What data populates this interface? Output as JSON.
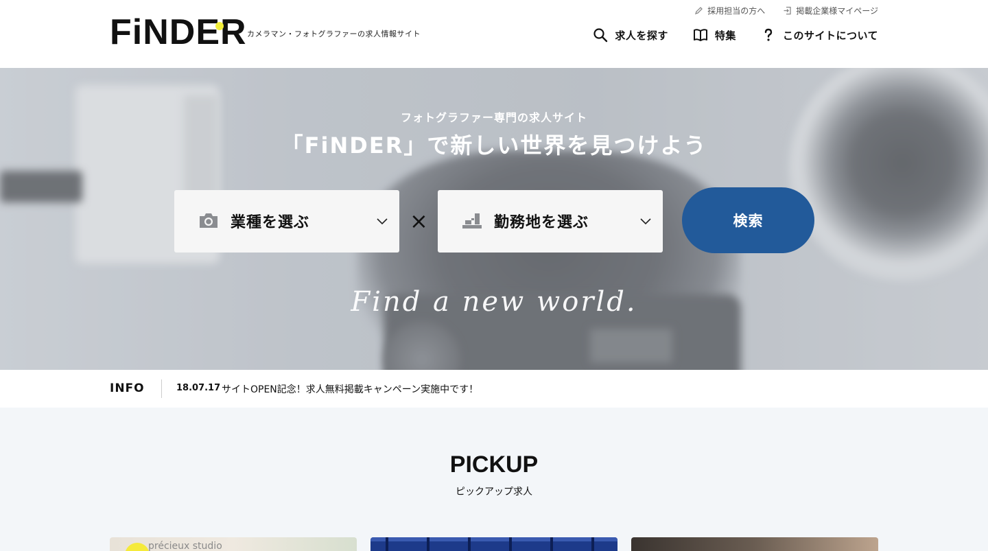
{
  "header": {
    "logo_text": "FiNDER",
    "tagline": "カメラマン・フォトグラファーの求人情報サイト",
    "util_links": [
      {
        "label": "採用担当の方へ",
        "icon": "pencil-icon"
      },
      {
        "label": "掲載企業様マイページ",
        "icon": "login-icon"
      }
    ],
    "nav": [
      {
        "label": "求人を探す",
        "icon": "search-icon"
      },
      {
        "label": "特集",
        "icon": "book-icon"
      },
      {
        "label": "このサイトについて",
        "icon": "question-icon"
      }
    ]
  },
  "hero": {
    "subtitle": "フォトグラファー専門の求人サイト",
    "title": "「FiNDER」で新しい世界を見つけよう",
    "select_industry": {
      "label": "業種を選ぶ",
      "icon": "camera-icon"
    },
    "times_symbol": "×",
    "select_location": {
      "label": "勤務地を選ぶ",
      "icon": "map-icon"
    },
    "search_button": "検索",
    "script_text": "Find a new world."
  },
  "info": {
    "label": "INFO",
    "date": "18.07.17",
    "text": "サイトOPEN記念！求人無料掲載キャンペーン実施中です！"
  },
  "pickup": {
    "title": "PICKUP",
    "subtitle": "ピックアップ求人",
    "cards": [
      {
        "visible_text": "précieux studio"
      },
      {
        "visible_text": ""
      },
      {
        "visible_text": ""
      }
    ]
  },
  "colors": {
    "brand_blue": "#225a9a",
    "logo_dot": "#f2ee3a",
    "pickup_bg": "#f3f6f9"
  }
}
